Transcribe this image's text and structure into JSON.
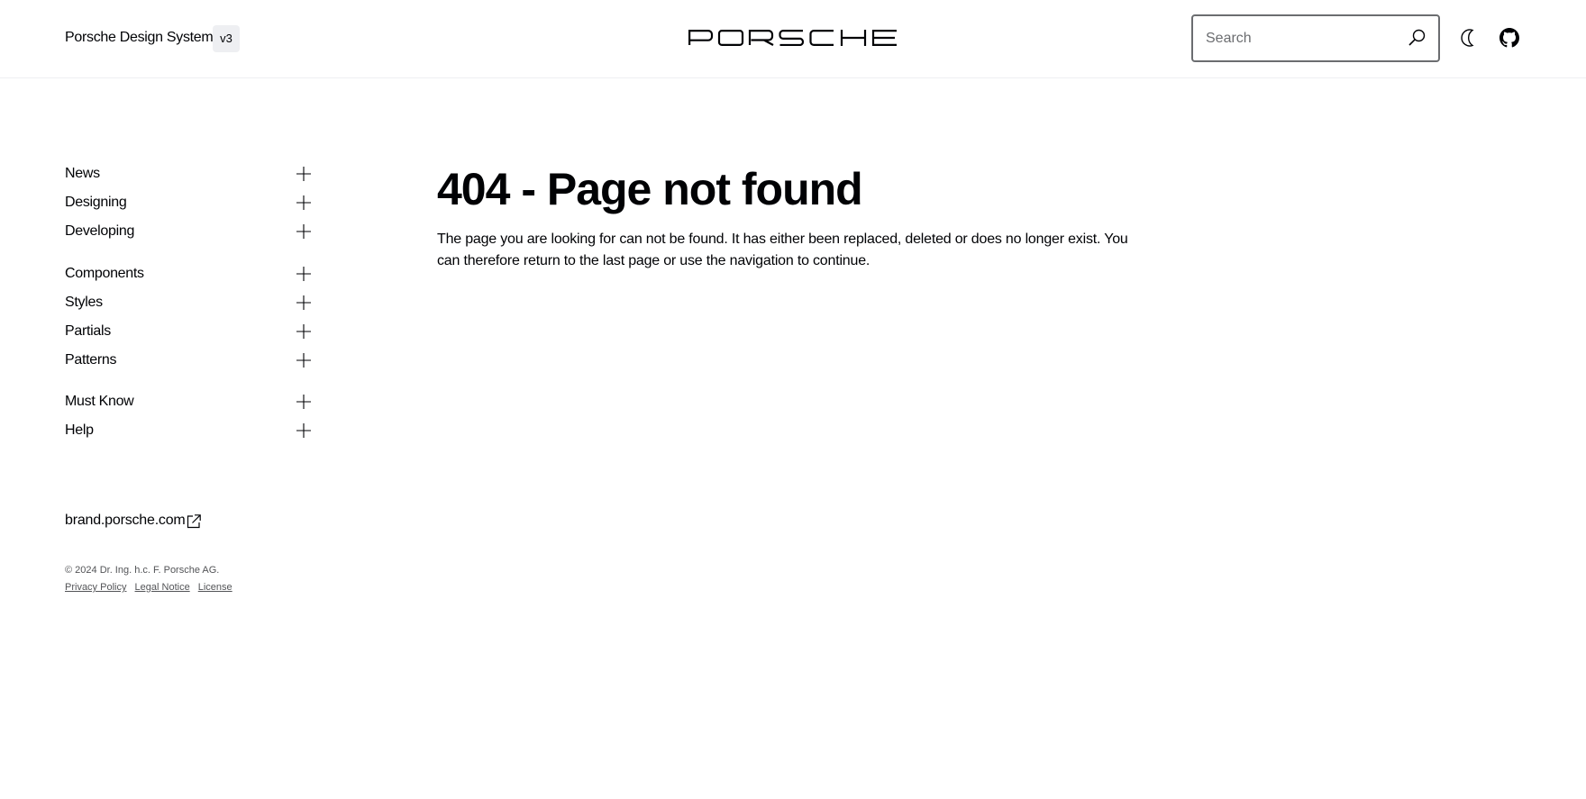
{
  "header": {
    "title": "Porsche Design System",
    "version": "v3",
    "logo_text": "PORSCHE",
    "search": {
      "placeholder": "Search",
      "value": ""
    },
    "icons": [
      "search-icon",
      "moon-icon",
      "github-icon"
    ]
  },
  "sidebar": {
    "items": [
      {
        "label": "News"
      },
      {
        "label": "Designing"
      },
      {
        "label": "Developing"
      },
      {
        "label": "Components"
      },
      {
        "label": "Styles"
      },
      {
        "label": "Partials"
      },
      {
        "label": "Patterns"
      },
      {
        "label": "Must Know"
      },
      {
        "label": "Help"
      }
    ],
    "brand_link": "brand.porsche.com",
    "copyright": "© 2024 Dr. Ing. h.c. F. Porsche AG.",
    "legal": {
      "privacy": "Privacy Policy",
      "notice": "Legal Notice",
      "license": "License"
    }
  },
  "main": {
    "title": "404 - Page not found",
    "text": "The page you are looking for can not be found. It has either been replaced, deleted or does no longer exist. You can therefore return to the last page or use the navigation to continue."
  }
}
